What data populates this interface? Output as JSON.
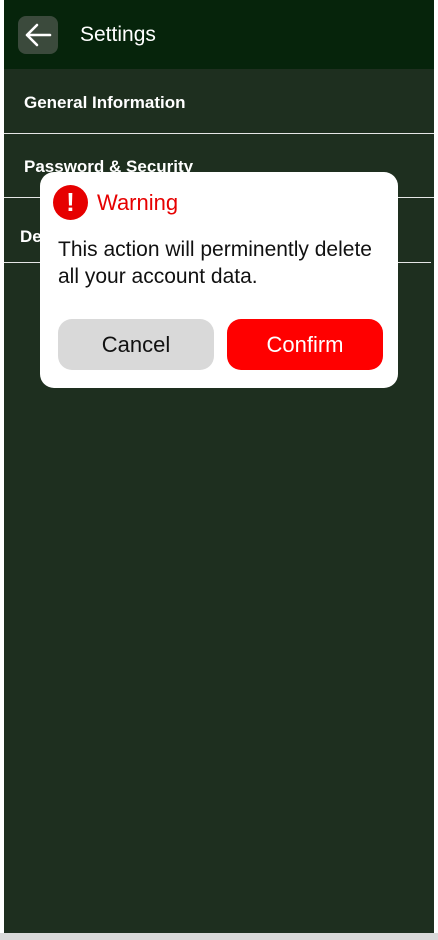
{
  "header": {
    "title": "Settings",
    "back_icon": "arrow-left-icon"
  },
  "menu": {
    "items": [
      {
        "label": "General Information"
      },
      {
        "label": "Password & Security"
      },
      {
        "label": "Delete Account"
      }
    ]
  },
  "dialog": {
    "icon": "exclamation-icon",
    "icon_glyph": "!",
    "title": "Warning",
    "message": "This action will perminently delete all your account data.",
    "cancel_label": "Cancel",
    "confirm_label": "Confirm"
  },
  "colors": {
    "background": "#1e2f1f",
    "header": "#06240b",
    "warning": "#e60000",
    "confirm": "#ff0000",
    "cancel": "#d9d9d9"
  }
}
